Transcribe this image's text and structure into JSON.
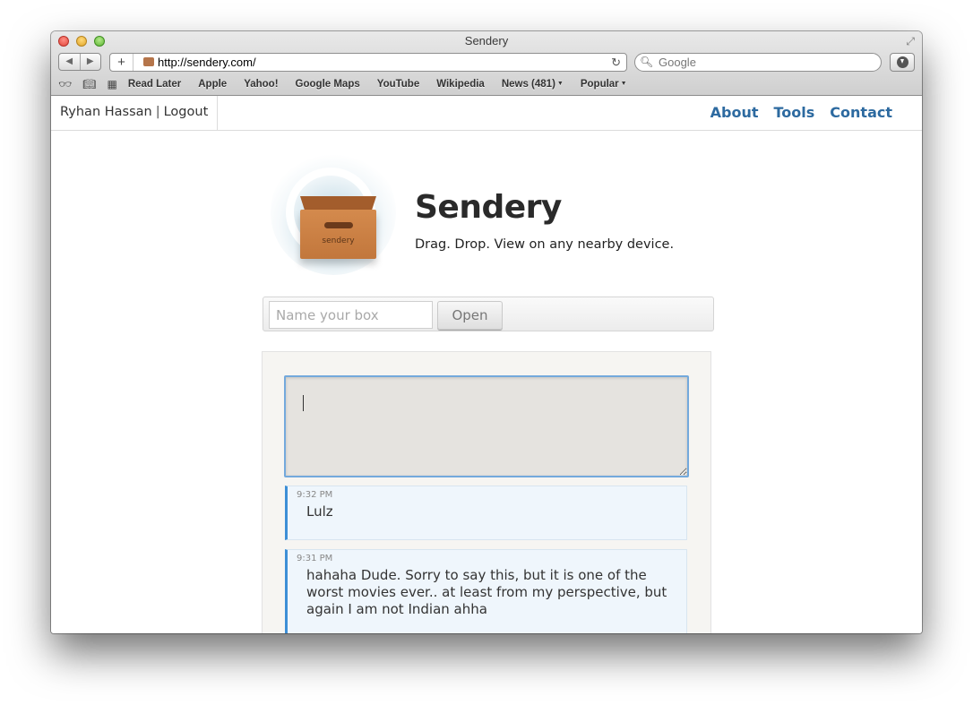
{
  "window": {
    "title": "Sendery"
  },
  "browser": {
    "url": "http://sendery.com/",
    "search_placeholder": "Google",
    "bookmarks": [
      {
        "label": "Read Later"
      },
      {
        "label": "Apple"
      },
      {
        "label": "Yahoo!"
      },
      {
        "label": "Google Maps"
      },
      {
        "label": "YouTube"
      },
      {
        "label": "Wikipedia"
      },
      {
        "label": "News (481)",
        "dropdown": true
      },
      {
        "label": "Popular",
        "dropdown": true
      }
    ]
  },
  "header": {
    "user_name": "Ryhan Hassan",
    "separator": "|",
    "logout_label": "Logout",
    "nav": [
      {
        "label": "About"
      },
      {
        "label": "Tools"
      },
      {
        "label": "Contact"
      }
    ]
  },
  "brand": {
    "logo_label": "sendery",
    "title": "Sendery",
    "tagline": "Drag. Drop. View on any nearby device."
  },
  "open_box": {
    "placeholder": "Name your box",
    "button_label": "Open"
  },
  "composer": {
    "value": ""
  },
  "messages": [
    {
      "time": "9:32 PM",
      "text": "Lulz"
    },
    {
      "time": "9:31 PM",
      "text": "hahaha Dude. Sorry to say this, but it is one of the worst movies ever.. at least from my perspective, but again I am not Indian ahha"
    }
  ],
  "colors": {
    "nav_link": "#2d6aa0",
    "message_accent": "#3d8fd6",
    "message_bg": "#eff6fc",
    "box_orange": "#c2773c"
  }
}
